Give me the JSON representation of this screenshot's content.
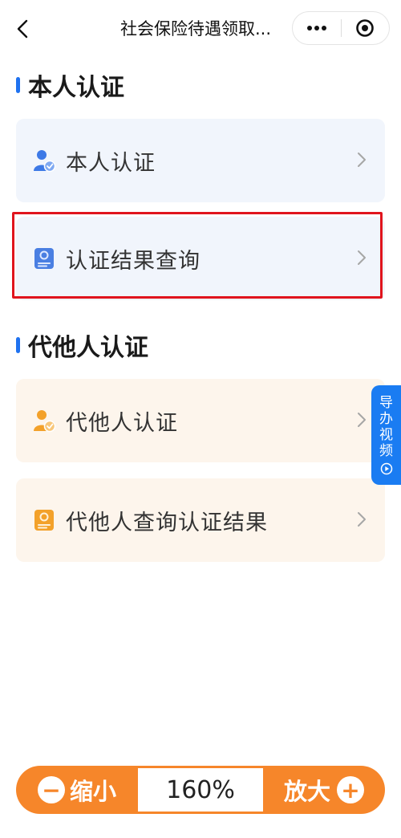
{
  "nav": {
    "title": "社会保险待遇领取...",
    "more_icon": "more-dots-icon",
    "close_icon": "target-close-icon"
  },
  "sections": [
    {
      "title": "本人认证",
      "items": [
        {
          "label": "本人认证",
          "icon": "person-verified-icon"
        },
        {
          "label": "认证结果查询",
          "icon": "certificate-icon"
        }
      ]
    },
    {
      "title": "代他人认证",
      "items": [
        {
          "label": "代他人认证",
          "icon": "person-verified-icon"
        },
        {
          "label": "代他人查询认证结果",
          "icon": "certificate-icon"
        }
      ]
    }
  ],
  "guide_tab": {
    "label": "导办视频"
  },
  "zoom": {
    "out_label": "缩小",
    "value": "160%",
    "in_label": "放大"
  },
  "colors": {
    "accent_blue": "#1f72f0",
    "accent_orange": "#f6862a",
    "highlight_red": "#e0141d"
  }
}
